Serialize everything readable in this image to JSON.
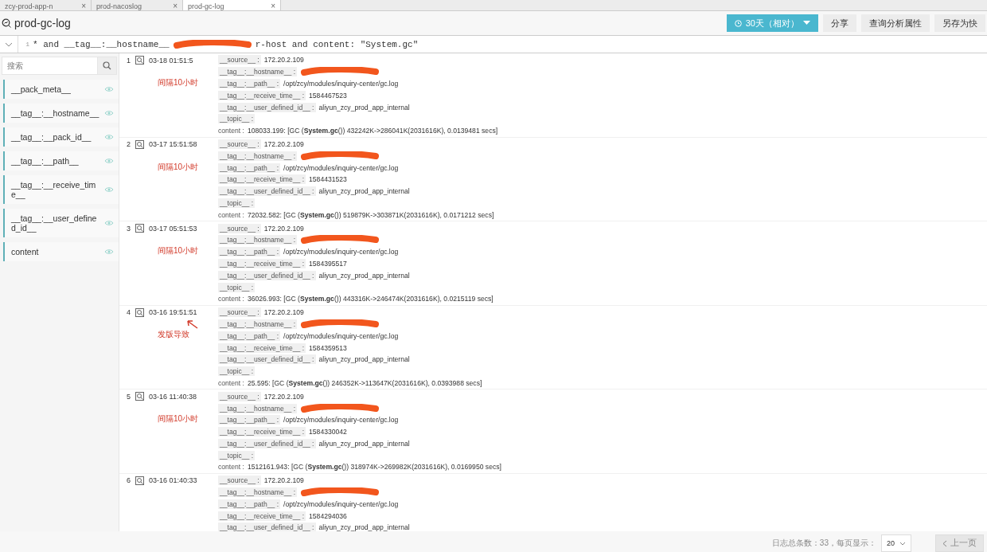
{
  "tabs": [
    {
      "label": "zcy-prod-app-n",
      "close": "×",
      "selected": false
    },
    {
      "label": "prod-nacoslog",
      "close": "×",
      "selected": false
    },
    {
      "label": "prod-gc-log",
      "close": "×",
      "selected": true
    }
  ],
  "title": "prod-gc-log",
  "toolbar": {
    "time_range": "30天（相对）",
    "buttons": [
      "分享",
      "查询分析属性",
      "另存为快"
    ]
  },
  "query": {
    "line_number": "1",
    "before": "* and __tag__:__hostname__",
    "after": "r-host and content: \"System.gc\""
  },
  "sidebar": {
    "search": {
      "placeholder": "搜索"
    },
    "fields": [
      "__pack_meta__",
      "__tag__:__hostname__",
      "__tag__:__pack_id__",
      "__tag__:__path__",
      "__tag__:__receive_time__",
      "__tag__:__user_defined_id__",
      "content"
    ]
  },
  "logs": [
    {
      "index": "1",
      "time": "03-18 01:51:5",
      "note": "间隔10小时",
      "arrow": false,
      "fields": [
        {
          "key": "__source__ :",
          "value": "172.20.2.109"
        },
        {
          "key": "__tag__:__hostname__ :",
          "redacted": true
        },
        {
          "key": "__tag__:__path__ :",
          "value": "/opt/zcy/modules/inquiry-center/gc.log"
        },
        {
          "key": "__tag__:__receive_time__ :",
          "value": "1584467523"
        },
        {
          "key": "__tag__:__user_defined_id__ :",
          "value": "aliyun_zcy_prod_app_internal"
        },
        {
          "key": "__topic__ :"
        },
        {
          "key": "content :",
          "value": "108033.199: [GC (**System.gc**()) 432242K->286041K(2031616K), 0.0139481 secs]"
        }
      ]
    },
    {
      "index": "2",
      "time": "03-17 15:51:58",
      "note": "间隔10小时",
      "arrow": false,
      "fields": [
        {
          "key": "__source__ :",
          "value": "172.20.2.109"
        },
        {
          "key": "__tag__:__hostname__ :",
          "redacted": true
        },
        {
          "key": "__tag__:__path__ :",
          "value": "/opt/zcy/modules/inquiry-center/gc.log"
        },
        {
          "key": "__tag__:__receive_time__ :",
          "value": "1584431523"
        },
        {
          "key": "__tag__:__user_defined_id__ :",
          "value": "aliyun_zcy_prod_app_internal"
        },
        {
          "key": "__topic__ :"
        },
        {
          "key": "content :",
          "value": "72032.582: [GC (**System.gc**()) 519879K->303871K(2031616K), 0.0171212 secs]"
        }
      ]
    },
    {
      "index": "3",
      "time": "03-17 05:51:53",
      "note": "间隔10小时",
      "arrow": false,
      "fields": [
        {
          "key": "__source__ :",
          "value": "172.20.2.109"
        },
        {
          "key": "__tag__:__hostname__ :",
          "redacted": true
        },
        {
          "key": "__tag__:__path__ :",
          "value": "/opt/zcy/modules/inquiry-center/gc.log"
        },
        {
          "key": "__tag__:__receive_time__ :",
          "value": "1584395517"
        },
        {
          "key": "__tag__:__user_defined_id__ :",
          "value": "aliyun_zcy_prod_app_internal"
        },
        {
          "key": "__topic__ :"
        },
        {
          "key": "content :",
          "value": "36026.993: [GC (**System.gc**()) 443316K->246474K(2031616K), 0.0215119 secs]"
        }
      ]
    },
    {
      "index": "4",
      "time": "03-16 19:51:51",
      "note": "发版导致",
      "arrow": true,
      "fields": [
        {
          "key": "__source__ :",
          "value": "172.20.2.109"
        },
        {
          "key": "__tag__:__hostname__ :",
          "redacted": true
        },
        {
          "key": "__tag__:__path__ :",
          "value": "/opt/zcy/modules/inquiry-center/gc.log"
        },
        {
          "key": "__tag__:__receive_time__ :",
          "value": "1584359513"
        },
        {
          "key": "__tag__:__user_defined_id__ :",
          "value": "aliyun_zcy_prod_app_internal"
        },
        {
          "key": "__topic__ :"
        },
        {
          "key": "content :",
          "value": "25.595: [GC (**System.gc**()) 246352K->113647K(2031616K), 0.0393988 secs]"
        }
      ]
    },
    {
      "index": "5",
      "time": "03-16 11:40:38",
      "note": "间隔10小时",
      "arrow": false,
      "fields": [
        {
          "key": "__source__ :",
          "value": "172.20.2.109"
        },
        {
          "key": "__tag__:__hostname__ :",
          "redacted": true
        },
        {
          "key": "__tag__:__path__ :",
          "value": "/opt/zcy/modules/inquiry-center/gc.log"
        },
        {
          "key": "__tag__:__receive_time__ :",
          "value": "1584330042"
        },
        {
          "key": "__tag__:__user_defined_id__ :",
          "value": "aliyun_zcy_prod_app_internal"
        },
        {
          "key": "__topic__ :"
        },
        {
          "key": "content :",
          "value": "1512161.943: [GC (**System.gc**()) 318974K->269982K(2031616K), 0.0169950 secs]"
        }
      ]
    },
    {
      "index": "6",
      "time": "03-16 01:40:33",
      "arrow": false,
      "fields": [
        {
          "key": "__source__ :",
          "value": "172.20.2.109"
        },
        {
          "key": "__tag__:__hostname__ :",
          "redacted": true
        },
        {
          "key": "__tag__:__path__ :",
          "value": "/opt/zcy/modules/inquiry-center/gc.log"
        },
        {
          "key": "__tag__:__receive_time__ :",
          "value": "1584294036"
        },
        {
          "key": "__tag__:__user_defined_id__ :",
          "value": "aliyun_zcy_prod_app_internal"
        }
      ]
    }
  ],
  "footer": {
    "total": "日志总条数：33，每页显示：",
    "page_size": "20",
    "prev": "上一页",
    "prev_disabled": true
  }
}
